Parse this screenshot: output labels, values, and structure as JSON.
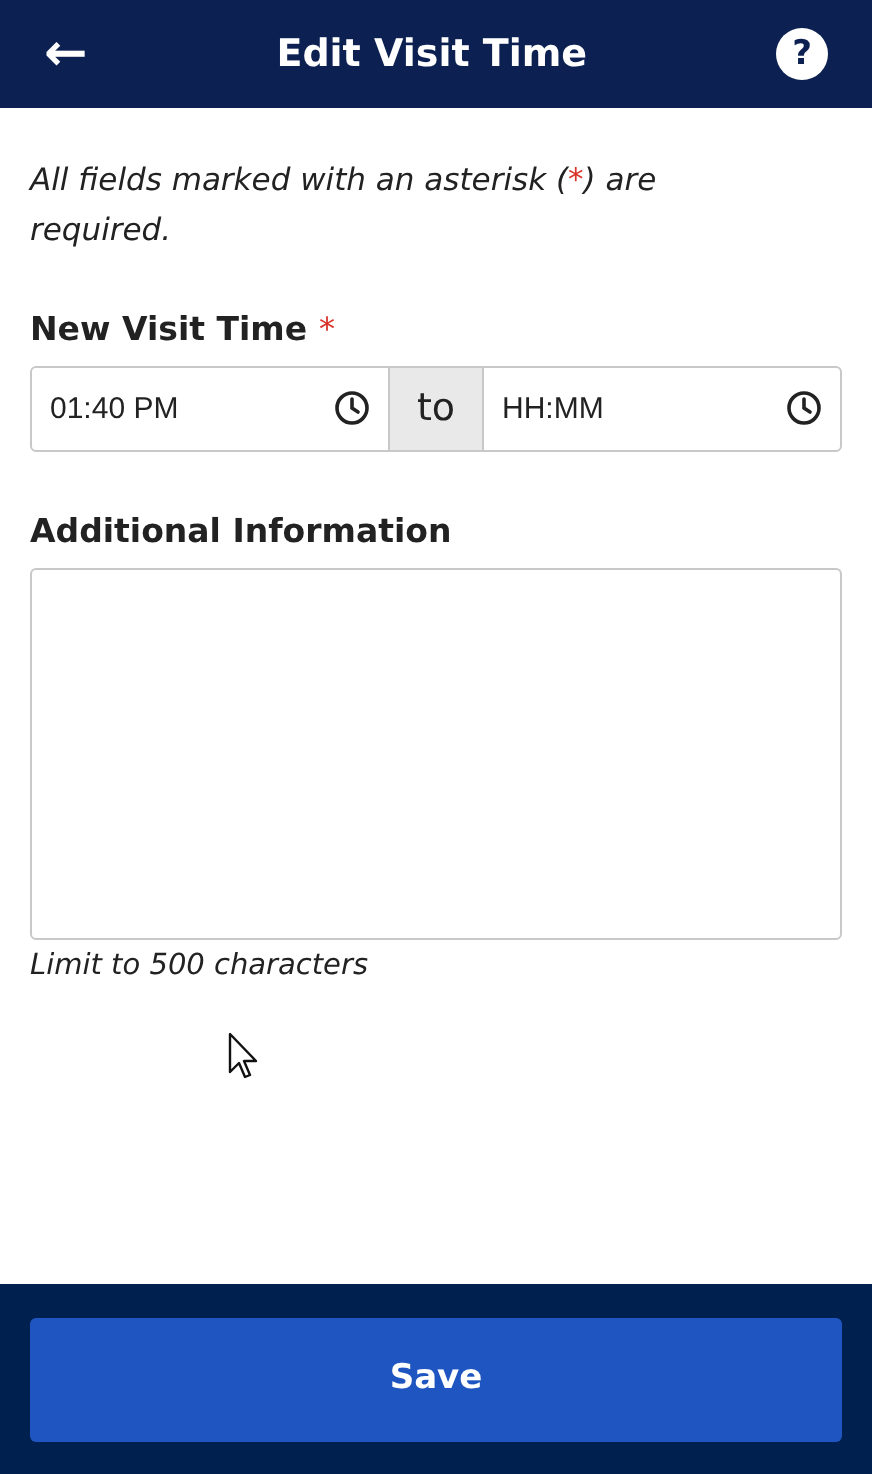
{
  "header": {
    "title": "Edit Visit Time",
    "back_icon": "←",
    "help_icon": "?"
  },
  "note": {
    "before": "All fields marked with an asterisk (",
    "mark": "*",
    "after": ") are required."
  },
  "visit_time": {
    "label": "New Visit Time",
    "required_mark": "*",
    "start": {
      "value": "01:40 PM"
    },
    "separator": "to",
    "end": {
      "placeholder": "HH:MM"
    }
  },
  "additional_information": {
    "label": "Additional Information",
    "hint": "Limit to 500 characters"
  },
  "save_button": "Save"
}
